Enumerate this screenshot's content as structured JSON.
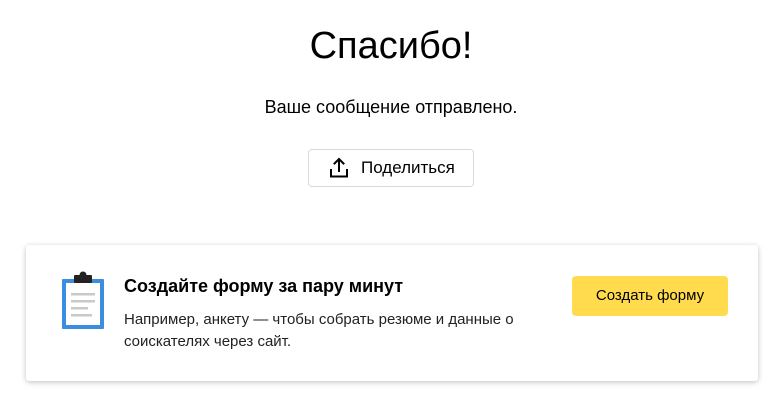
{
  "confirmation": {
    "title": "Спасибо!",
    "message": "Ваше сообщение отправлено.",
    "share_label": "Поделиться",
    "share_icon": "share-upload-icon"
  },
  "promo": {
    "icon": "clipboard-form-icon",
    "title": "Создайте форму за пару минут",
    "description": "Например, анкету — чтобы собрать резюме и данные о соискателях через сайт.",
    "button_label": "Создать форму",
    "accent_color": "#ffdb4d",
    "icon_color": "#3b8de0"
  }
}
